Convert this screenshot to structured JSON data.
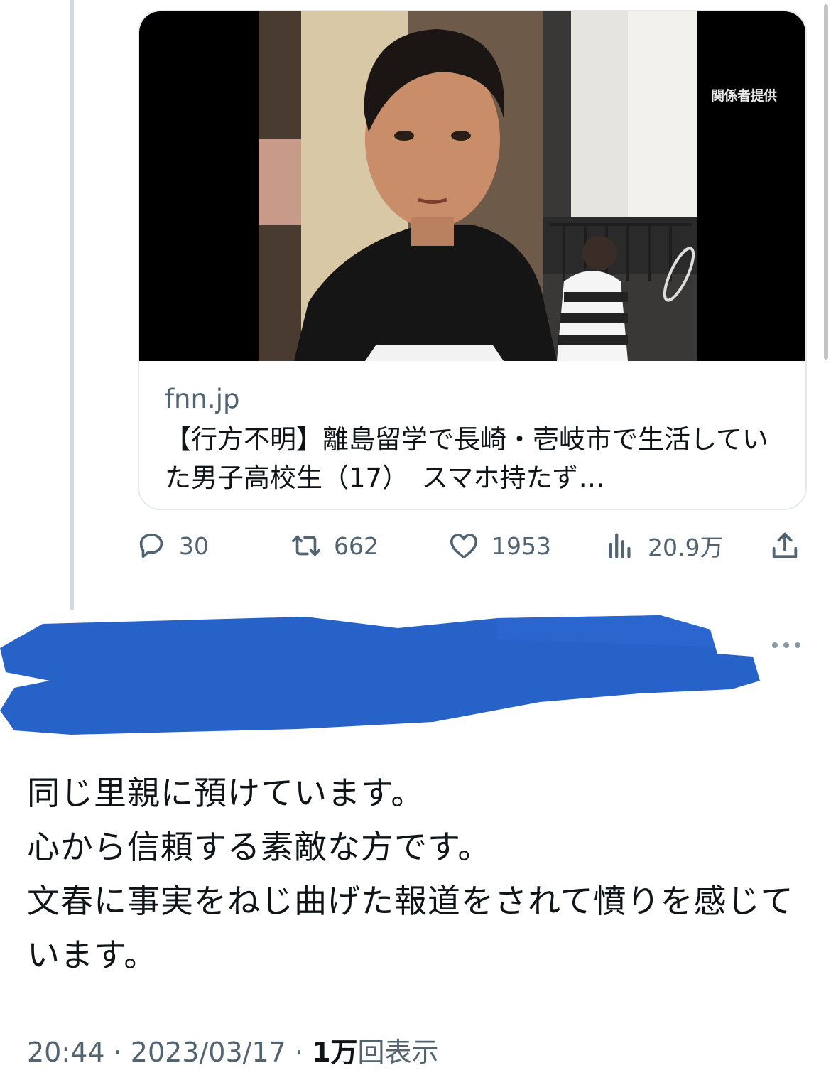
{
  "link_card": {
    "image_credit": "関係者提供",
    "domain": "fnn.jp",
    "title": "【行方不明】離島留学で長崎・壱岐市で生活していた男子高校生（17）　スマホ持たず…"
  },
  "actions": {
    "reply_count": "30",
    "retweet_count": "662",
    "like_count": "1953",
    "view_count": "20.9万"
  },
  "reply": {
    "lines": [
      "同じ里親に預けています。",
      "心から信頼する素敵な方です。",
      "文春に事実をねじ曲げた報道をされて憤りを感じて",
      "います。"
    ],
    "time": "20:44",
    "date": "2023/03/17",
    "views_number": "1万",
    "views_label": "回表示"
  },
  "colors": {
    "text": "#0f1419",
    "secondary": "#536471",
    "redaction": "#2762c9",
    "border": "#e7eaed"
  },
  "icons": [
    "reply-icon",
    "retweet-icon",
    "like-icon",
    "views-icon",
    "share-icon",
    "more-icon"
  ]
}
